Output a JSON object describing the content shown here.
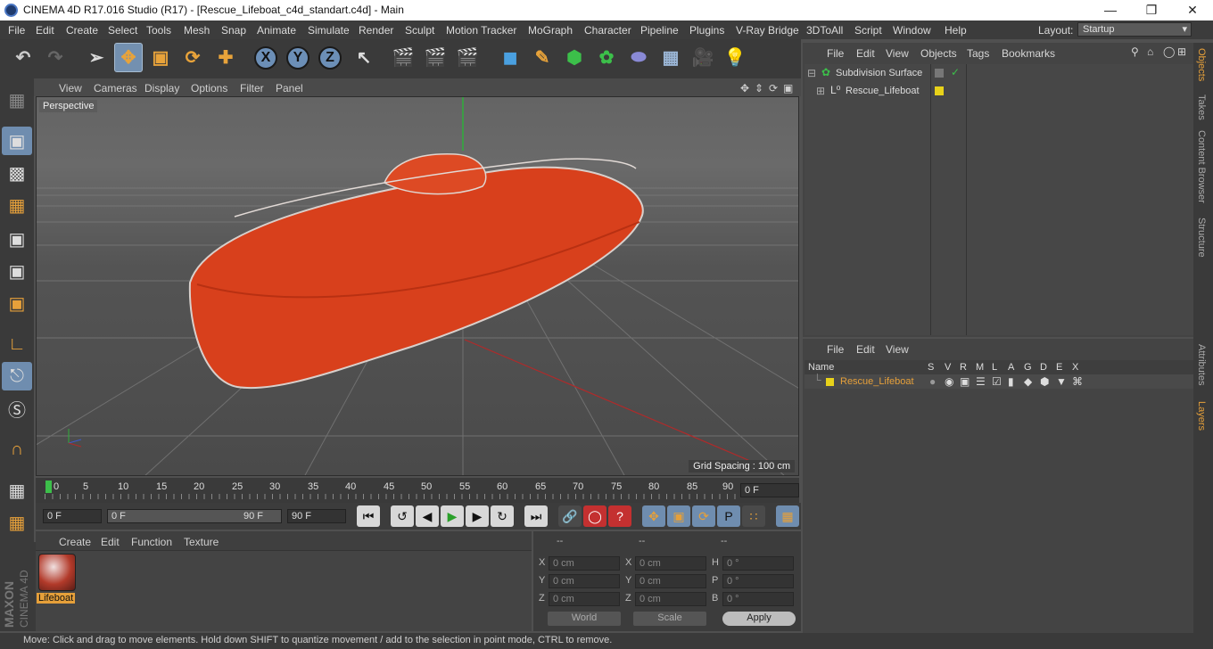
{
  "window": {
    "title": "CINEMA 4D R17.016 Studio (R17) - [Rescue_Lifeboat_c4d_standart.c4d] - Main"
  },
  "menubar": {
    "items": [
      "File",
      "Edit",
      "Create",
      "Select",
      "Tools",
      "Mesh",
      "Snap",
      "Animate",
      "Simulate",
      "Render",
      "Sculpt",
      "Motion Tracker",
      "MoGraph",
      "Character",
      "Pipeline",
      "Plugins",
      "V-Ray Bridge",
      "3DToAll",
      "Script",
      "Window",
      "Help"
    ],
    "layout_label": "Layout:",
    "layout_value": "Startup"
  },
  "toolbar": {
    "axis_x": "X",
    "axis_y": "Y",
    "axis_z": "Z"
  },
  "viewport": {
    "menu": [
      "View",
      "Cameras",
      "Display",
      "Options",
      "Filter",
      "Panel"
    ],
    "camera_label": "Perspective",
    "grid_spacing": "Grid Spacing : 100 cm"
  },
  "timeline": {
    "ticks": [
      "0",
      "5",
      "10",
      "15",
      "20",
      "25",
      "30",
      "35",
      "40",
      "45",
      "50",
      "55",
      "60",
      "65",
      "70",
      "75",
      "80",
      "85",
      "90"
    ],
    "current_frame": "0 F",
    "start_frame": "0 F",
    "range_start": "0 F",
    "range_end": "90 F",
    "end_frame": "90 F"
  },
  "material": {
    "menu": [
      "Create",
      "Edit",
      "Function",
      "Texture"
    ],
    "name": "Lifeboat"
  },
  "coordinates": {
    "header": [
      "--",
      "--",
      "--"
    ],
    "rows": [
      {
        "a": "X",
        "av": "0 cm",
        "b": "X",
        "bv": "0 cm",
        "c": "H",
        "cv": "0 °"
      },
      {
        "a": "Y",
        "av": "0 cm",
        "b": "Y",
        "bv": "0 cm",
        "c": "P",
        "cv": "0 °"
      },
      {
        "a": "Z",
        "av": "0 cm",
        "b": "Z",
        "bv": "0 cm",
        "c": "B",
        "cv": "0 °"
      }
    ],
    "world": "World",
    "scale": "Scale",
    "apply": "Apply"
  },
  "objects": {
    "menu": [
      "File",
      "Edit",
      "View",
      "Objects",
      "Tags",
      "Bookmarks"
    ],
    "items": [
      "Subdivision Surface",
      "Rescue_Lifeboat"
    ]
  },
  "layers": {
    "menu": [
      "File",
      "Edit",
      "View"
    ],
    "columns": [
      "Name",
      "S",
      "V",
      "R",
      "M",
      "L",
      "A",
      "G",
      "D",
      "E",
      "X"
    ],
    "item": "Rescue_Lifeboat"
  },
  "side_tabs": [
    "Objects",
    "Takes",
    "Content Browser",
    "Structure",
    "Attributes",
    "Layers"
  ],
  "status": "Move: Click and drag to move elements. Hold down SHIFT to quantize movement / add to the selection in point mode, CTRL to remove.",
  "branding": {
    "maxon": "MAXON",
    "c4d": "CINEMA 4D"
  },
  "colors": {
    "accent": "#e6a03a",
    "boat": "#d8401c",
    "layer_yellow": "#e8d21a"
  }
}
